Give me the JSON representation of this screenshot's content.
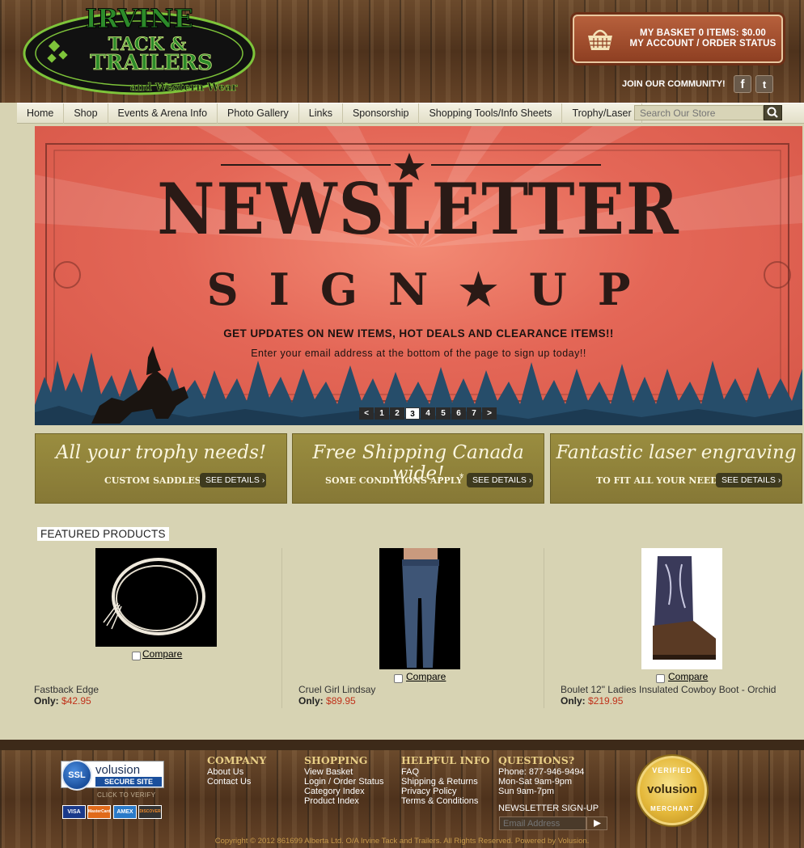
{
  "header": {
    "logo": {
      "line1": "IRVINE",
      "line2": "TACK &",
      "line3": "TRAILERS",
      "line4": "and Western Wear"
    },
    "basket": {
      "line1": "MY BASKET 0 ITEMS: $0.00",
      "line2": "MY ACCOUNT / ORDER STATUS"
    },
    "community_label": "JOIN OUR COMMUNITY!"
  },
  "nav": {
    "items": [
      {
        "label": "Home"
      },
      {
        "label": "Shop"
      },
      {
        "label": "Events & Arena Info"
      },
      {
        "label": "Photo Gallery"
      },
      {
        "label": "Links"
      },
      {
        "label": "Sponsorship"
      },
      {
        "label": "Shopping Tools/Info Sheets"
      },
      {
        "label": "Trophy/Laser"
      }
    ],
    "search_placeholder": "Search Our Store"
  },
  "banner": {
    "title": "NEWSLETTER",
    "subtitle": "SIGN★UP",
    "line1": "GET UPDATES ON NEW ITEMS, HOT DEALS AND CLEARANCE ITEMS!!",
    "line2": "Enter your email address at the bottom of the page to sign up today!!",
    "pager": [
      "<",
      "1",
      "2",
      "3",
      "4",
      "5",
      "6",
      "7",
      ">"
    ],
    "active_page": "3"
  },
  "promos": [
    {
      "title": "All your trophy needs!",
      "sub": "CUSTOM SADDLES!",
      "button": "SEE DETAILS"
    },
    {
      "title": "Free Shipping Canada wide!",
      "sub": "SOME CONDITIONS APPLY",
      "star": "*",
      "button": "SEE DETAILS"
    },
    {
      "title": "Fantastic laser engraving",
      "sub": "TO FIT ALL YOUR NEEDS",
      "button": "SEE DETAILS"
    }
  ],
  "featured": {
    "label": "FEATURED PRODUCTS",
    "compare_label": "Compare",
    "price_prefix": "Only:",
    "products": [
      {
        "name": "Fastback Edge",
        "price": "$42.95"
      },
      {
        "name": "Cruel Girl Lindsay",
        "price": "$89.95"
      },
      {
        "name": "Boulet 12\" Ladies Insulated Cowboy Boot - Orchid",
        "price": "$219.95"
      }
    ]
  },
  "footer": {
    "ssl": {
      "badge": "SSL",
      "brand": "volusion",
      "site": "SECURE SITE",
      "verify": "CLICK TO VERIFY"
    },
    "cards": [
      "VISA",
      "MasterCard",
      "AMEX",
      "DISCOVER"
    ],
    "company": {
      "heading": "COMPANY",
      "links": [
        "About Us",
        "Contact Us"
      ]
    },
    "shopping": {
      "heading": "SHOPPING",
      "links": [
        "View Basket",
        "Login / Order Status",
        "Category Index",
        "Product Index"
      ]
    },
    "helpful": {
      "heading": "HELPFUL INFO",
      "links": [
        "FAQ",
        "Shipping & Returns",
        "Privacy Policy",
        "Terms & Conditions"
      ]
    },
    "questions": {
      "heading": "QUESTIONS?",
      "lines": [
        "Phone: 877-946-9494",
        "Mon-Sat 9am-9pm",
        "Sun 9am-7pm"
      ]
    },
    "newsletter": {
      "heading": "NEWSLETTER SIGN-UP",
      "placeholder": "Email Address"
    },
    "seal": {
      "top": "VERIFIED",
      "brand": "volusion",
      "bottom": "MERCHANT"
    },
    "copyright": "Copyright © 2012 861699 Alberta Ltd. O/A Irvine Tack and Trailers. All Rights Reserved. Powered by Volusion."
  },
  "colors": {
    "accent": "#8e3f22",
    "price": "#c0311a",
    "promo": "#8f823a",
    "banner": "#e46757"
  }
}
